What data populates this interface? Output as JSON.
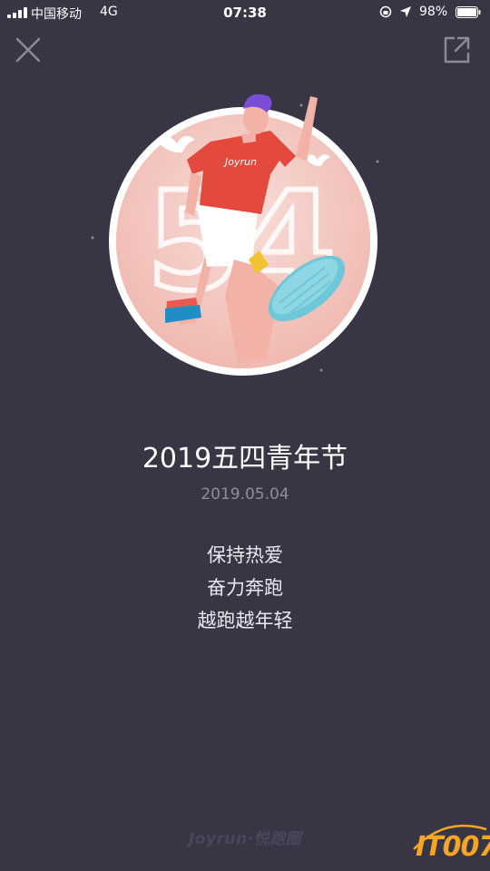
{
  "status_bar": {
    "carrier": "中国移动",
    "network": "4G",
    "time": "07:38",
    "battery": "98%"
  },
  "icons": {
    "close": "close-icon",
    "share": "share-icon"
  },
  "badge": {
    "number": "54",
    "shirt_text": "Joyrun"
  },
  "main": {
    "title": "2019五四青年节",
    "date": "2019.05.04",
    "lines": [
      "保持热爱",
      "奋力奔跑",
      "越跑越年轻"
    ]
  },
  "footer": {
    "logo": "Joyrun·悦跑圈"
  },
  "watermark": "IT007",
  "colors": {
    "background": "#383645",
    "badge_disc": "#f4c9c2",
    "shirt": "#e4493e",
    "shoe": "#6ec6d9",
    "hair": "#7a4fd8",
    "watermark": "#f6a623"
  }
}
